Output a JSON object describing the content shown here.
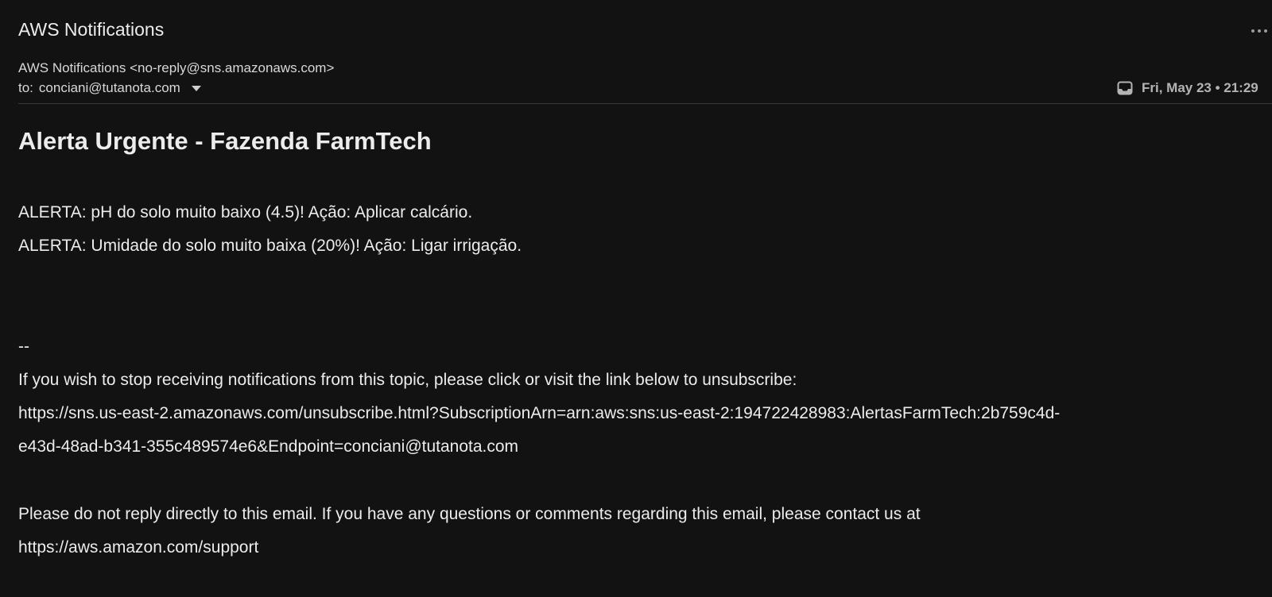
{
  "header": {
    "subject": "AWS Notifications",
    "from": "AWS Notifications <no-reply@sns.amazonaws.com>",
    "to_label": "to:",
    "to_address": "conciani@tutanota.com",
    "date": "Fri, May 23 • 21:29",
    "more_icon": "more-horizontal-icon",
    "folder_icon": "inbox-icon"
  },
  "message": {
    "title": "Alerta Urgente - Fazenda FarmTech",
    "alerts": [
      "ALERTA: pH do solo muito baixo (4.5)! Ação: Aplicar calcário.",
      "ALERTA: Umidade do solo muito baixa (20%)! Ação: Ligar irrigação."
    ],
    "signature_separator": "--",
    "unsubscribe_text": "If you wish to stop receiving notifications from this topic, please click or visit the link below to unsubscribe:",
    "unsubscribe_link_line1": "https://sns.us-east-2.amazonaws.com/unsubscribe.html?SubscriptionArn=arn:aws:sns:us-east-2:194722428983:AlertasFarmTech:2b759c4d-",
    "unsubscribe_link_line2": "e43d-48ad-b341-355c489574e6&Endpoint=conciani@tutanota.com",
    "footer_text": "Please do not reply directly to this email. If you have any questions or comments regarding this email, please contact us at",
    "support_link": "https://aws.amazon.com/support"
  },
  "colors": {
    "background": "#121212",
    "text": "#ececec",
    "muted": "#b4b4b4",
    "divider": "#3a3a3a"
  }
}
